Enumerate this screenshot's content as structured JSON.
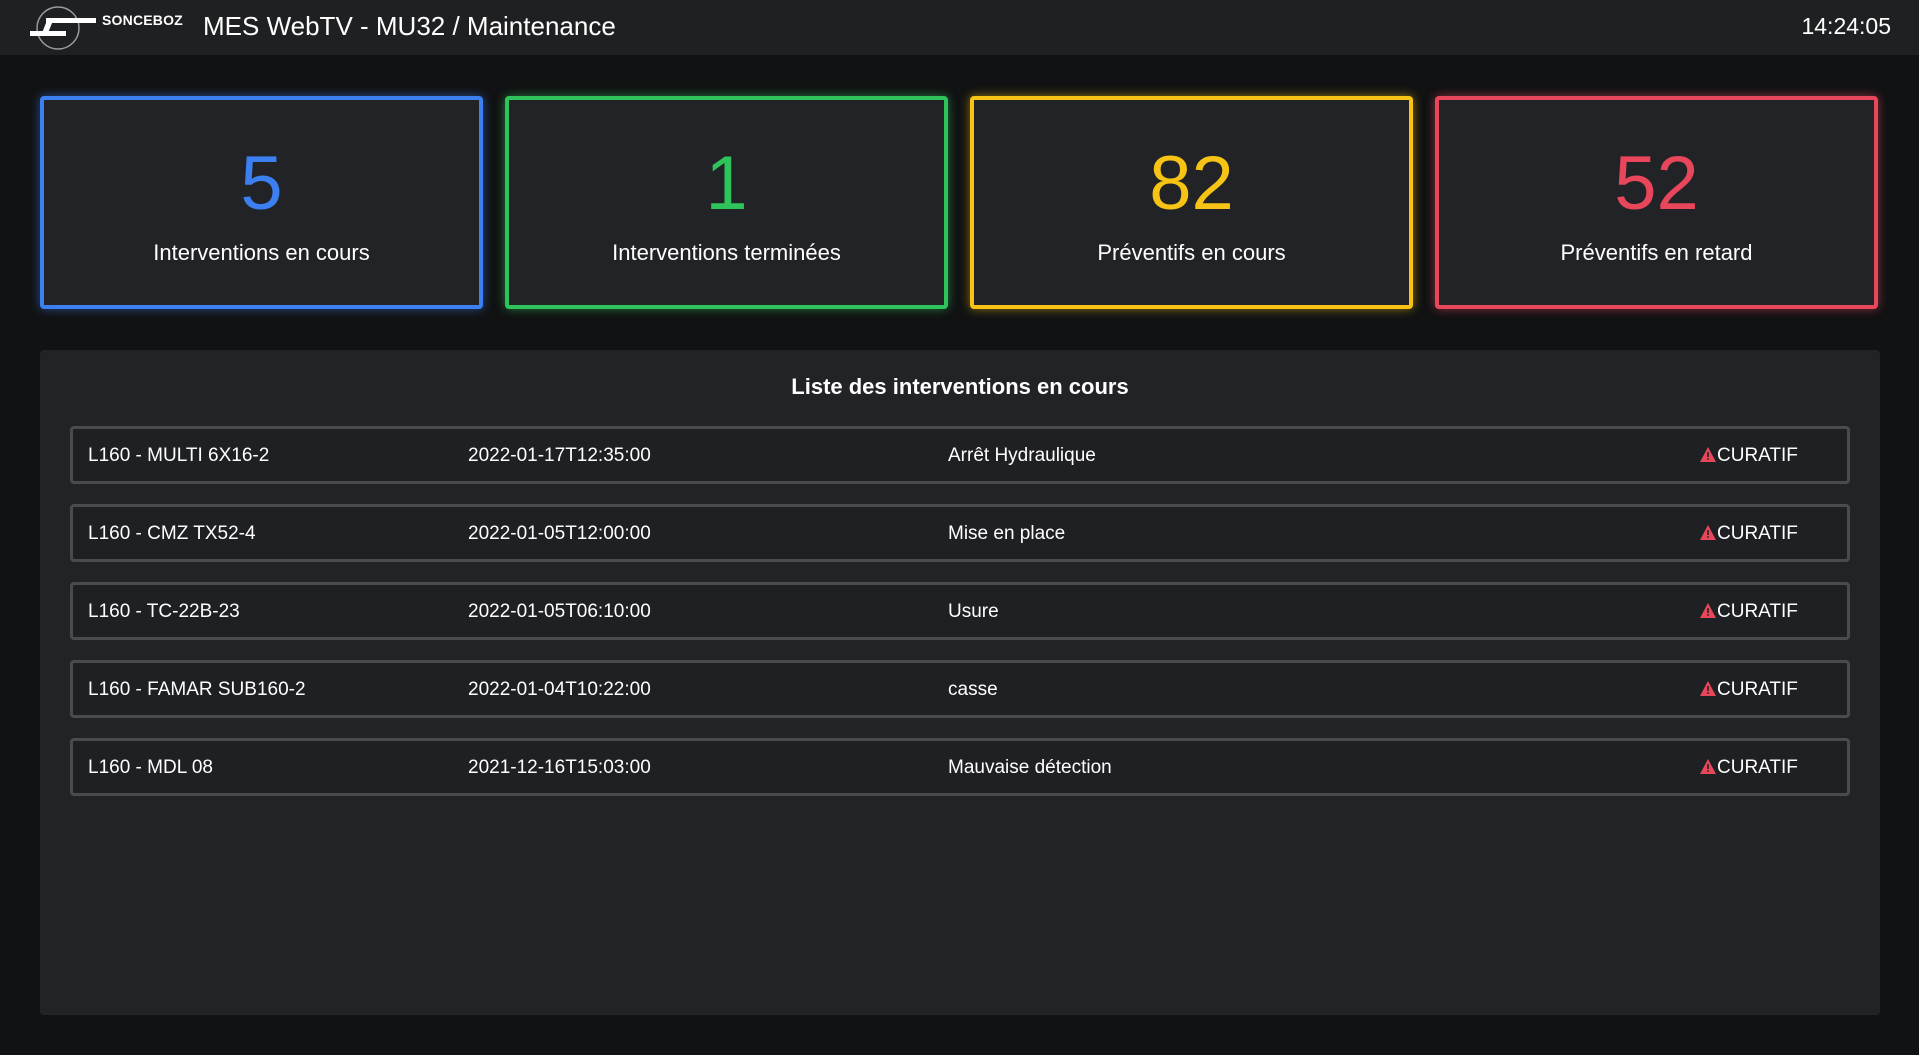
{
  "header": {
    "logo_text": "SONCEBOZ",
    "title": "MES WebTV - MU32 / Maintenance",
    "clock": "14:24:05"
  },
  "kpis": [
    {
      "value": "5",
      "label": "Interventions en cours",
      "color": "#3b7ff0"
    },
    {
      "value": "1",
      "label": "Interventions terminées",
      "color": "#2fc35c"
    },
    {
      "value": "82",
      "label": "Préventifs en cours",
      "color": "#f7c416"
    },
    {
      "value": "52",
      "label": "Préventifs en retard",
      "color": "#e8465a"
    }
  ],
  "interventions": {
    "title": "Liste des interventions en cours",
    "warning_icon": "warning-triangle-icon",
    "warning_color": "#e8465a",
    "rows": [
      {
        "machine": "L160 - MULTI 6X16-2",
        "date": "2022-01-17T12:35:00",
        "reason": "Arrêt Hydraulique",
        "type": "CURATIF"
      },
      {
        "machine": "L160 - CMZ TX52-4",
        "date": "2022-01-05T12:00:00",
        "reason": "Mise en place",
        "type": "CURATIF"
      },
      {
        "machine": "L160 - TC-22B-23",
        "date": "2022-01-05T06:10:00",
        "reason": "Usure",
        "type": "CURATIF"
      },
      {
        "machine": "L160 - FAMAR SUB160-2",
        "date": "2022-01-04T10:22:00",
        "reason": "casse",
        "type": "CURATIF"
      },
      {
        "machine": "L160 - MDL 08",
        "date": "2021-12-16T15:03:00",
        "reason": "Mauvaise détection",
        "type": "CURATIF"
      }
    ]
  }
}
